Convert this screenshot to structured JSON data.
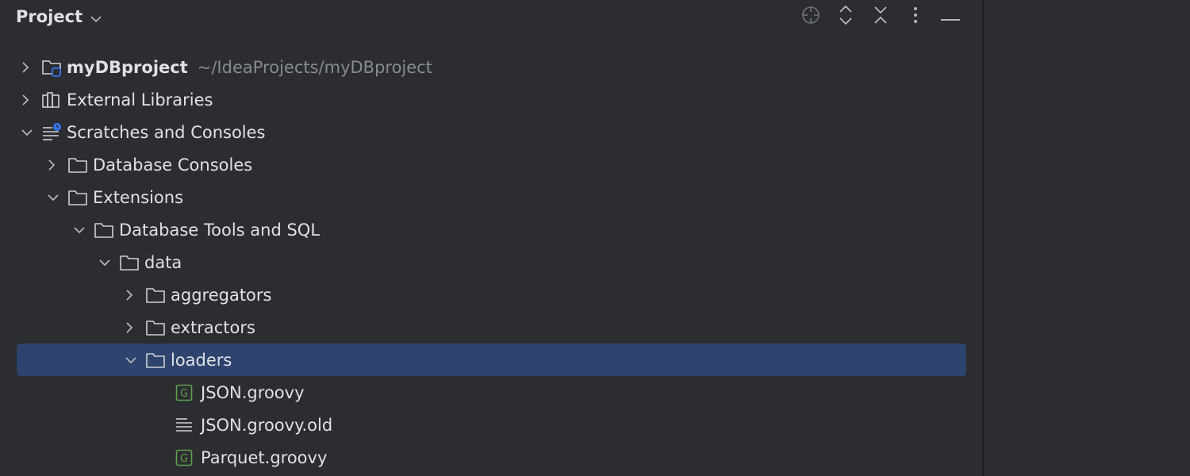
{
  "header": {
    "title": "Project"
  },
  "tree": {
    "root": {
      "label": "myDBproject",
      "path": "~/IdeaProjects/myDBproject"
    },
    "external": {
      "label": "External Libraries"
    },
    "scratches": {
      "label": "Scratches and Consoles"
    },
    "db_consoles": {
      "label": "Database Consoles"
    },
    "extensions": {
      "label": "Extensions"
    },
    "db_tools": {
      "label": "Database Tools and SQL"
    },
    "data": {
      "label": "data"
    },
    "aggregators": {
      "label": "aggregators"
    },
    "extractors": {
      "label": "extractors"
    },
    "loaders": {
      "label": "loaders"
    },
    "json_groovy": {
      "label": "JSON.groovy"
    },
    "json_groovy_old": {
      "label": "JSON.groovy.old"
    },
    "parquet_groovy": {
      "label": "Parquet.groovy"
    }
  },
  "colors": {
    "background": "#2b2d30",
    "selection": "#2e436e",
    "text": "#dfe1e5",
    "muted": "#868a91",
    "groovy": "#5fa14e",
    "badge": "#3574f0"
  },
  "icons": {
    "header": [
      "chevron-down-icon"
    ],
    "toolbar": [
      "locate-icon",
      "expand-all-icon",
      "collapse-all-icon",
      "more-options-icon",
      "hide-icon"
    ]
  }
}
